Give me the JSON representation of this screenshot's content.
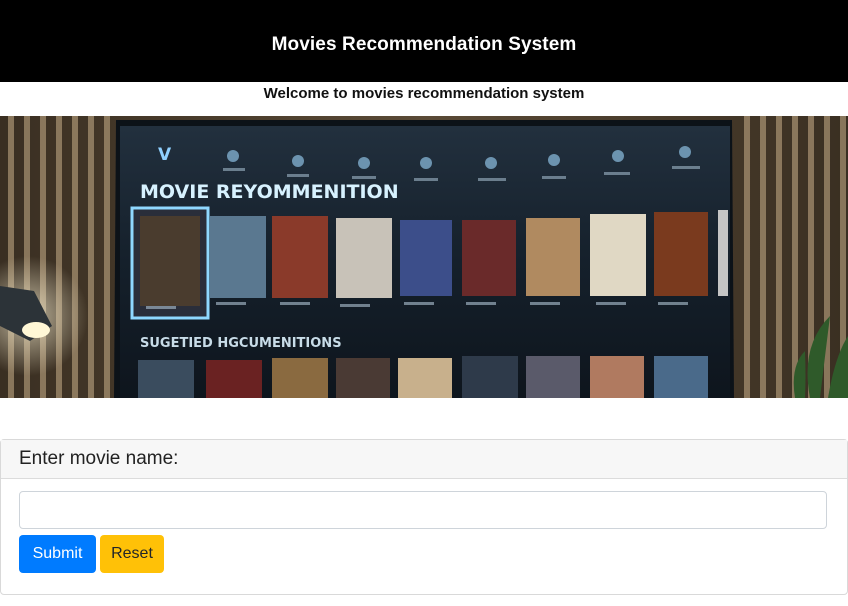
{
  "header": {
    "title": "Movies Recommendation System"
  },
  "welcome": "Welcome to movies recommendation system",
  "banner": {
    "heading": "MOVIE REYOMMENITION",
    "subheading": "SUGETIED HGCUMENITIONS",
    "logo": "V"
  },
  "form": {
    "label": "Enter movie name:",
    "input_value": "",
    "input_placeholder": "",
    "submit_label": "Submit",
    "reset_label": "Reset"
  },
  "colors": {
    "header_bg": "#000000",
    "submit": "#007bff",
    "reset": "#ffc107"
  }
}
